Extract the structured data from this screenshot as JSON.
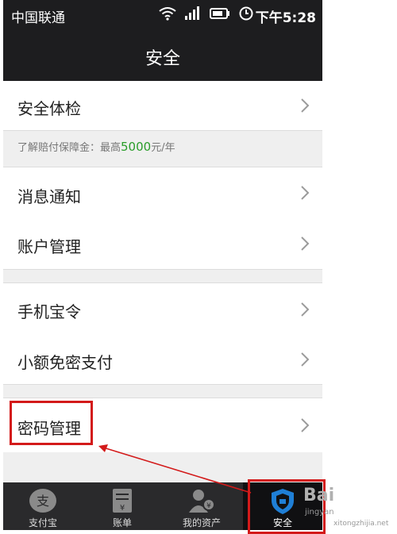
{
  "status_bar": {
    "carrier": "中国联通",
    "time": "下午5:28",
    "icons": [
      "wifi-icon",
      "signal-icon",
      "battery-icon",
      "alarm-icon"
    ]
  },
  "header": {
    "title": "安全"
  },
  "menu": {
    "security_check": "安全体检",
    "info_prefix": "了解赔付保障金：最高",
    "info_amount": "5000",
    "info_suffix": "元/年",
    "message_notify": "消息通知",
    "account_manage": "账户管理",
    "phone_token": "手机宝令",
    "small_pay": "小额免密支付",
    "password_manage": "密码管理"
  },
  "tabs": [
    {
      "label": "支付宝",
      "icon": "alipay-icon"
    },
    {
      "label": "账单",
      "icon": "bill-icon"
    },
    {
      "label": "我的资产",
      "icon": "assets-icon"
    },
    {
      "label": "安全",
      "icon": "shield-icon"
    }
  ],
  "watermark": {
    "text1": "Bai",
    "text2": "jingyan",
    "text3": "xitongzhijia.net"
  },
  "colors": {
    "dark": "#1d1d1f",
    "accent_red": "#d31a1a",
    "green": "#2a9d2a",
    "shield_blue": "#1f7fd6"
  }
}
